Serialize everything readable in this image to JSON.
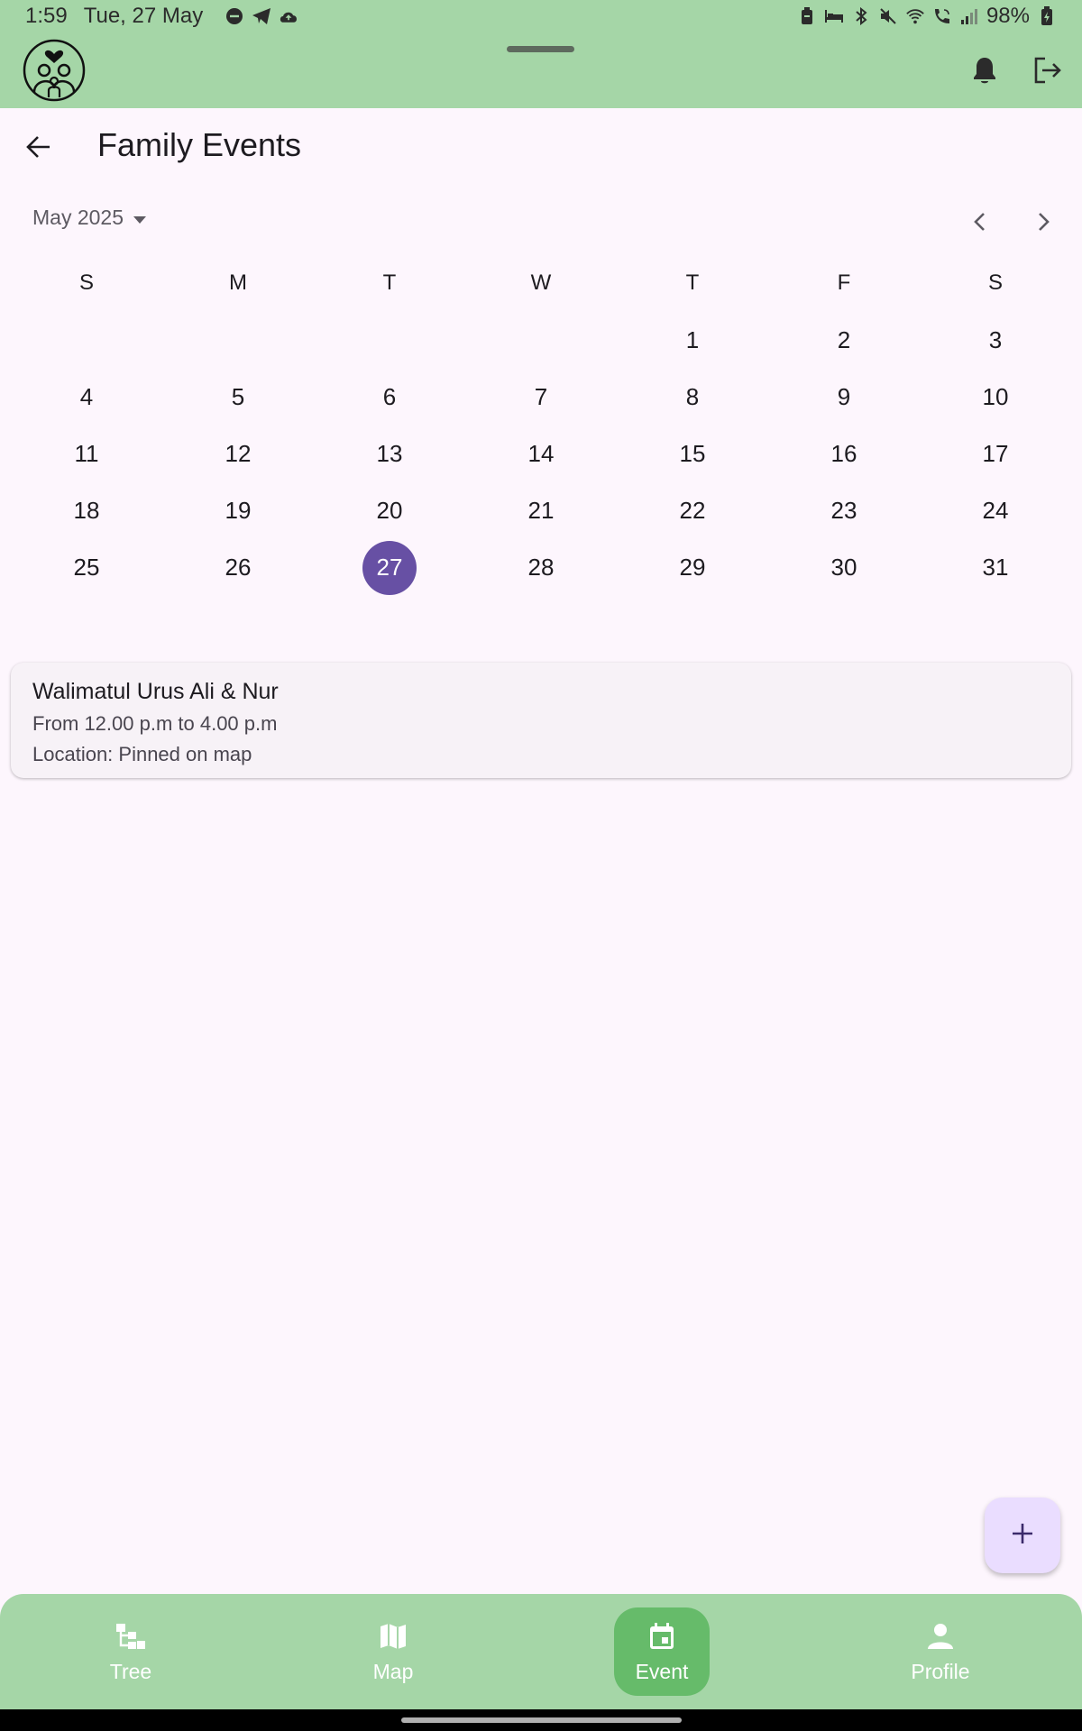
{
  "status_bar": {
    "time": "1:59",
    "date": "Tue, 27 May",
    "battery": "98%"
  },
  "header": {
    "title": "Family Events"
  },
  "calendar": {
    "month_label": "May 2025",
    "weekdays": [
      "S",
      "M",
      "T",
      "W",
      "T",
      "F",
      "S"
    ],
    "weeks": [
      [
        "",
        "",
        "",
        "",
        "1",
        "2",
        "3"
      ],
      [
        "4",
        "5",
        "6",
        "7",
        "8",
        "9",
        "10"
      ],
      [
        "11",
        "12",
        "13",
        "14",
        "15",
        "16",
        "17"
      ],
      [
        "18",
        "19",
        "20",
        "21",
        "22",
        "23",
        "24"
      ],
      [
        "25",
        "26",
        "27",
        "28",
        "29",
        "30",
        "31"
      ]
    ],
    "selected_day": "27",
    "selected_color": "#6750a4"
  },
  "event": {
    "title": "Walimatul Urus Ali & Nur",
    "time": "From 12.00 p.m to 4.00 p.m",
    "location": "Location: Pinned on map"
  },
  "fab": {
    "icon": "plus-icon"
  },
  "bottom_nav": {
    "items": [
      {
        "label": "Tree",
        "icon": "tree-icon"
      },
      {
        "label": "Map",
        "icon": "map-icon"
      },
      {
        "label": "Event",
        "icon": "calendar-icon"
      },
      {
        "label": "Profile",
        "icon": "person-icon"
      }
    ],
    "active": "Event"
  },
  "colors": {
    "app_bar": "#a5d6a7",
    "nav_active": "#66bb6a",
    "background": "#fdf6fd",
    "fab": "#eaddff"
  }
}
